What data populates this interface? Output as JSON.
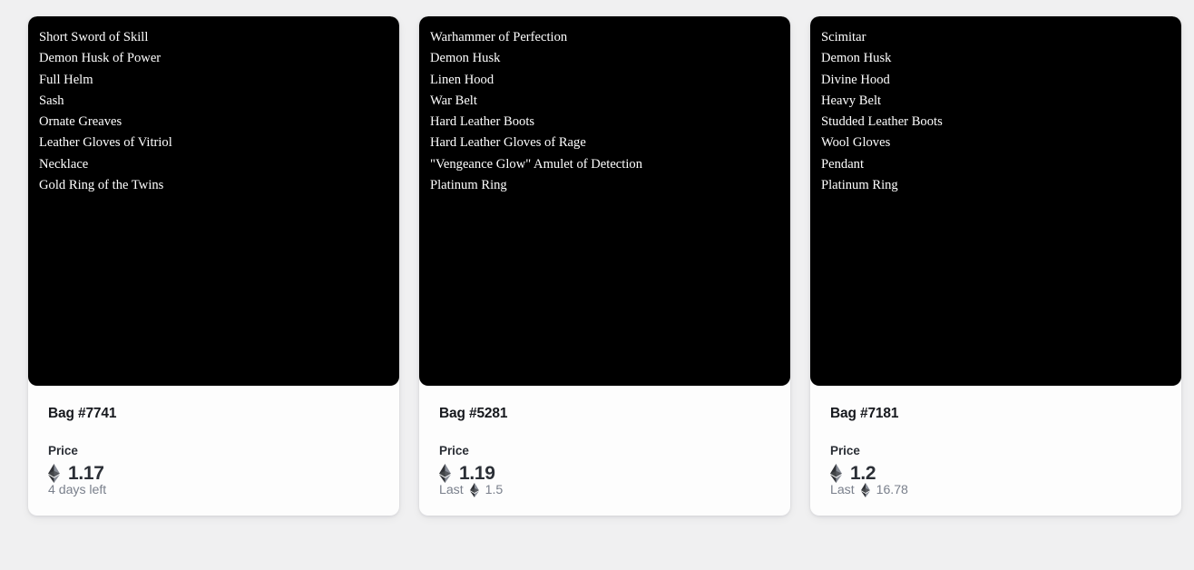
{
  "page": {
    "background_color": "#f0f0f1",
    "card_background_color": "#fdfdfd",
    "art_background_color": "#000000",
    "text_color": "#2b2f36",
    "muted_text_color": "#7a808c"
  },
  "labels": {
    "price": "Price",
    "last": "Last",
    "eth_icon": "ethereum-icon"
  },
  "cards": [
    {
      "title": "Bag #7741",
      "items": [
        "Short Sword of Skill",
        "Demon Husk of Power",
        "Full Helm",
        "Sash",
        "Ornate Greaves",
        "Leather Gloves of Vitriol",
        "Necklace",
        "Gold Ring of the Twins"
      ],
      "price_label": "Price",
      "price_value": "1.17",
      "meta_prefix": "",
      "meta_has_eth": false,
      "meta_text": "4 days left"
    },
    {
      "title": "Bag #5281",
      "items": [
        "Warhammer of Perfection",
        "Demon Husk",
        "Linen Hood",
        "War Belt",
        "Hard Leather Boots",
        "Hard Leather Gloves of Rage",
        "\"Vengeance Glow\" Amulet of Detection",
        "Platinum Ring"
      ],
      "price_label": "Price",
      "price_value": "1.19",
      "meta_prefix": "Last",
      "meta_has_eth": true,
      "meta_text": "1.5"
    },
    {
      "title": "Bag #7181",
      "items": [
        "Scimitar",
        "Demon Husk",
        "Divine Hood",
        "Heavy Belt",
        "Studded Leather Boots",
        "Wool Gloves",
        "Pendant",
        "Platinum Ring"
      ],
      "price_label": "Price",
      "price_value": "1.2",
      "meta_prefix": "Last",
      "meta_has_eth": true,
      "meta_text": "16.78"
    }
  ]
}
